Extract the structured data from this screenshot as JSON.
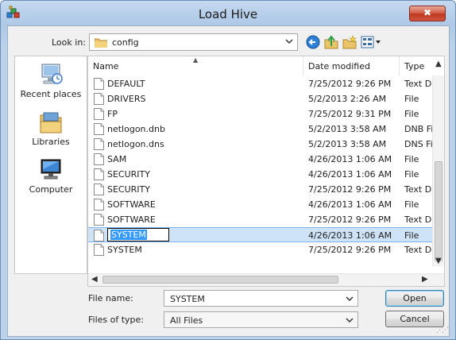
{
  "window": {
    "title": "Load Hive",
    "close_label": "✖"
  },
  "lookin": {
    "label": "Look in:",
    "value": "config"
  },
  "places": [
    {
      "label": "Recent places"
    },
    {
      "label": "Libraries"
    },
    {
      "label": "Computer"
    }
  ],
  "columns": {
    "name": "Name",
    "date": "Date modified",
    "type": "Type"
  },
  "files": [
    {
      "name": "DEFAULT",
      "date": "7/25/2012 9:26 PM",
      "type": "Text Do"
    },
    {
      "name": "DRIVERS",
      "date": "5/2/2013 2:26 AM",
      "type": "File"
    },
    {
      "name": "FP",
      "date": "7/25/2012 9:31 PM",
      "type": "File"
    },
    {
      "name": "netlogon.dnb",
      "date": "5/2/2013 3:58 AM",
      "type": "DNB Fi"
    },
    {
      "name": "netlogon.dns",
      "date": "5/2/2013 3:58 AM",
      "type": "DNS Fi"
    },
    {
      "name": "SAM",
      "date": "4/26/2013 1:06 AM",
      "type": "File"
    },
    {
      "name": "SECURITY",
      "date": "4/26/2013 1:06 AM",
      "type": "File"
    },
    {
      "name": "SECURITY",
      "date": "7/25/2012 9:26 PM",
      "type": "Text Do"
    },
    {
      "name": "SOFTWARE",
      "date": "4/26/2013 1:06 AM",
      "type": "File"
    },
    {
      "name": "SOFTWARE",
      "date": "7/25/2012 9:26 PM",
      "type": "Text Do"
    },
    {
      "name": "SYSTEM",
      "date": "4/26/2013 1:06 AM",
      "type": "File"
    },
    {
      "name": "SYSTEM",
      "date": "7/25/2012 9:26 PM",
      "type": "Text Do"
    }
  ],
  "filename": {
    "label": "File name:",
    "value": "SYSTEM"
  },
  "filetype": {
    "label": "Files of type:",
    "value": "All Files"
  },
  "buttons": {
    "open": "Open",
    "cancel": "Cancel"
  }
}
